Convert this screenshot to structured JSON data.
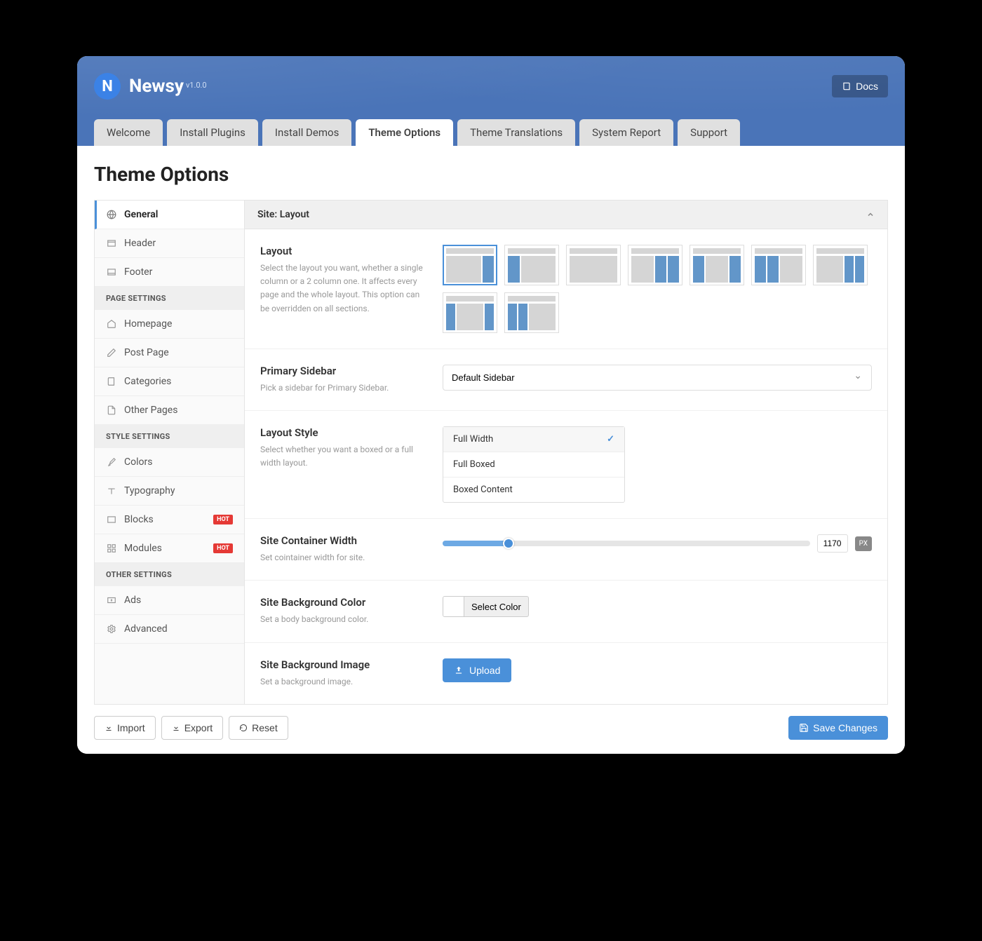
{
  "brand": {
    "name": "Newsy",
    "version": "v1.0.0"
  },
  "docs_label": "Docs",
  "tabs": [
    "Welcome",
    "Install Plugins",
    "Install Demos",
    "Theme Options",
    "Theme Translations",
    "System Report",
    "Support"
  ],
  "page_title": "Theme Options",
  "sidebar": {
    "items_top": [
      {
        "label": "General"
      },
      {
        "label": "Header"
      },
      {
        "label": "Footer"
      }
    ],
    "page_settings_header": "PAGE SETTINGS",
    "items_page": [
      {
        "label": "Homepage"
      },
      {
        "label": "Post Page"
      },
      {
        "label": "Categories"
      },
      {
        "label": "Other Pages"
      }
    ],
    "style_settings_header": "STYLE SETTINGS",
    "items_style": [
      {
        "label": "Colors"
      },
      {
        "label": "Typography"
      },
      {
        "label": "Blocks",
        "hot": "HOT"
      },
      {
        "label": "Modules",
        "hot": "HOT"
      }
    ],
    "other_settings_header": "OTHER SETTINGS",
    "items_other": [
      {
        "label": "Ads"
      },
      {
        "label": "Advanced"
      }
    ]
  },
  "panel": {
    "header": "Site: Layout",
    "layout": {
      "title": "Layout",
      "desc": "Select the layout you want, whether a single column or a 2 column one. It affects every page and the whole layout. This option can be overridden on all sections."
    },
    "primary_sidebar": {
      "title": "Primary Sidebar",
      "desc": "Pick a sidebar for Primary Sidebar.",
      "value": "Default Sidebar"
    },
    "layout_style": {
      "title": "Layout Style",
      "desc": "Select whether you want a boxed or a full width layout.",
      "options": [
        "Full Width",
        "Full Boxed",
        "Boxed Content"
      ]
    },
    "container_width": {
      "title": "Site Container Width",
      "desc": "Set cointainer width for site.",
      "value": "1170",
      "unit": "PX"
    },
    "bg_color": {
      "title": "Site Background Color",
      "desc": "Set a body background color.",
      "btn": "Select Color"
    },
    "bg_image": {
      "title": "Site Background Image",
      "desc": "Set a background image.",
      "btn": "Upload"
    }
  },
  "footer": {
    "import": "Import",
    "export": "Export",
    "reset": "Reset",
    "save": "Save Changes"
  }
}
